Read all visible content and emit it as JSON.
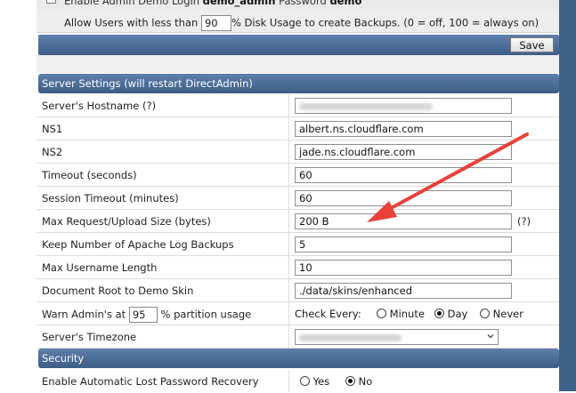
{
  "top": {
    "cut_label_prefix": "Enable Admin Demo Login",
    "cut_user": "demo_admin",
    "cut_password_label": "Password",
    "cut_password": "demo",
    "allow_prefix": "Allow Users with less than",
    "allow_value": "90",
    "allow_suffix": "% Disk Usage to create Backups. (0 = off, 100 = always on)"
  },
  "save_label": "Save",
  "server_settings": {
    "header": "Server Settings (will restart DirectAdmin)",
    "hostname_label": "Server's Hostname (?)",
    "ns1_label": "NS1",
    "ns1_value": "albert.ns.cloudflare.com",
    "ns2_label": "NS2",
    "ns2_value": "jade.ns.cloudflare.com",
    "timeout_label": "Timeout (seconds)",
    "timeout_value": "60",
    "session_label": "Session Timeout (minutes)",
    "session_value": "60",
    "maxreq_label": "Max Request/Upload Size (bytes)",
    "maxreq_value": "200 B",
    "maxreq_help": "(?)",
    "apache_label": "Keep Number of Apache Log Backups",
    "apache_value": "5",
    "username_label": "Max Username Length",
    "username_value": "10",
    "docroot_label": "Document Root to Demo Skin",
    "docroot_value": "./data/skins/enhanced",
    "warn_prefix": "Warn Admin's at",
    "warn_value": "95",
    "warn_suffix": "% partition usage",
    "check_every_label": "Check Every:",
    "check_minute": "Minute",
    "check_day": "Day",
    "check_never": "Never",
    "check_selected": "Day",
    "timezone_label": "Server's Timezone"
  },
  "security": {
    "header": "Security",
    "lost_pw_label": "Enable Automatic Lost Password Recovery",
    "yes": "Yes",
    "no": "No",
    "selected": "No"
  },
  "colors": {
    "header_blue": "#4a6b96",
    "side_bar": "#3f6087",
    "annotation_arrow": "#e8413a"
  }
}
